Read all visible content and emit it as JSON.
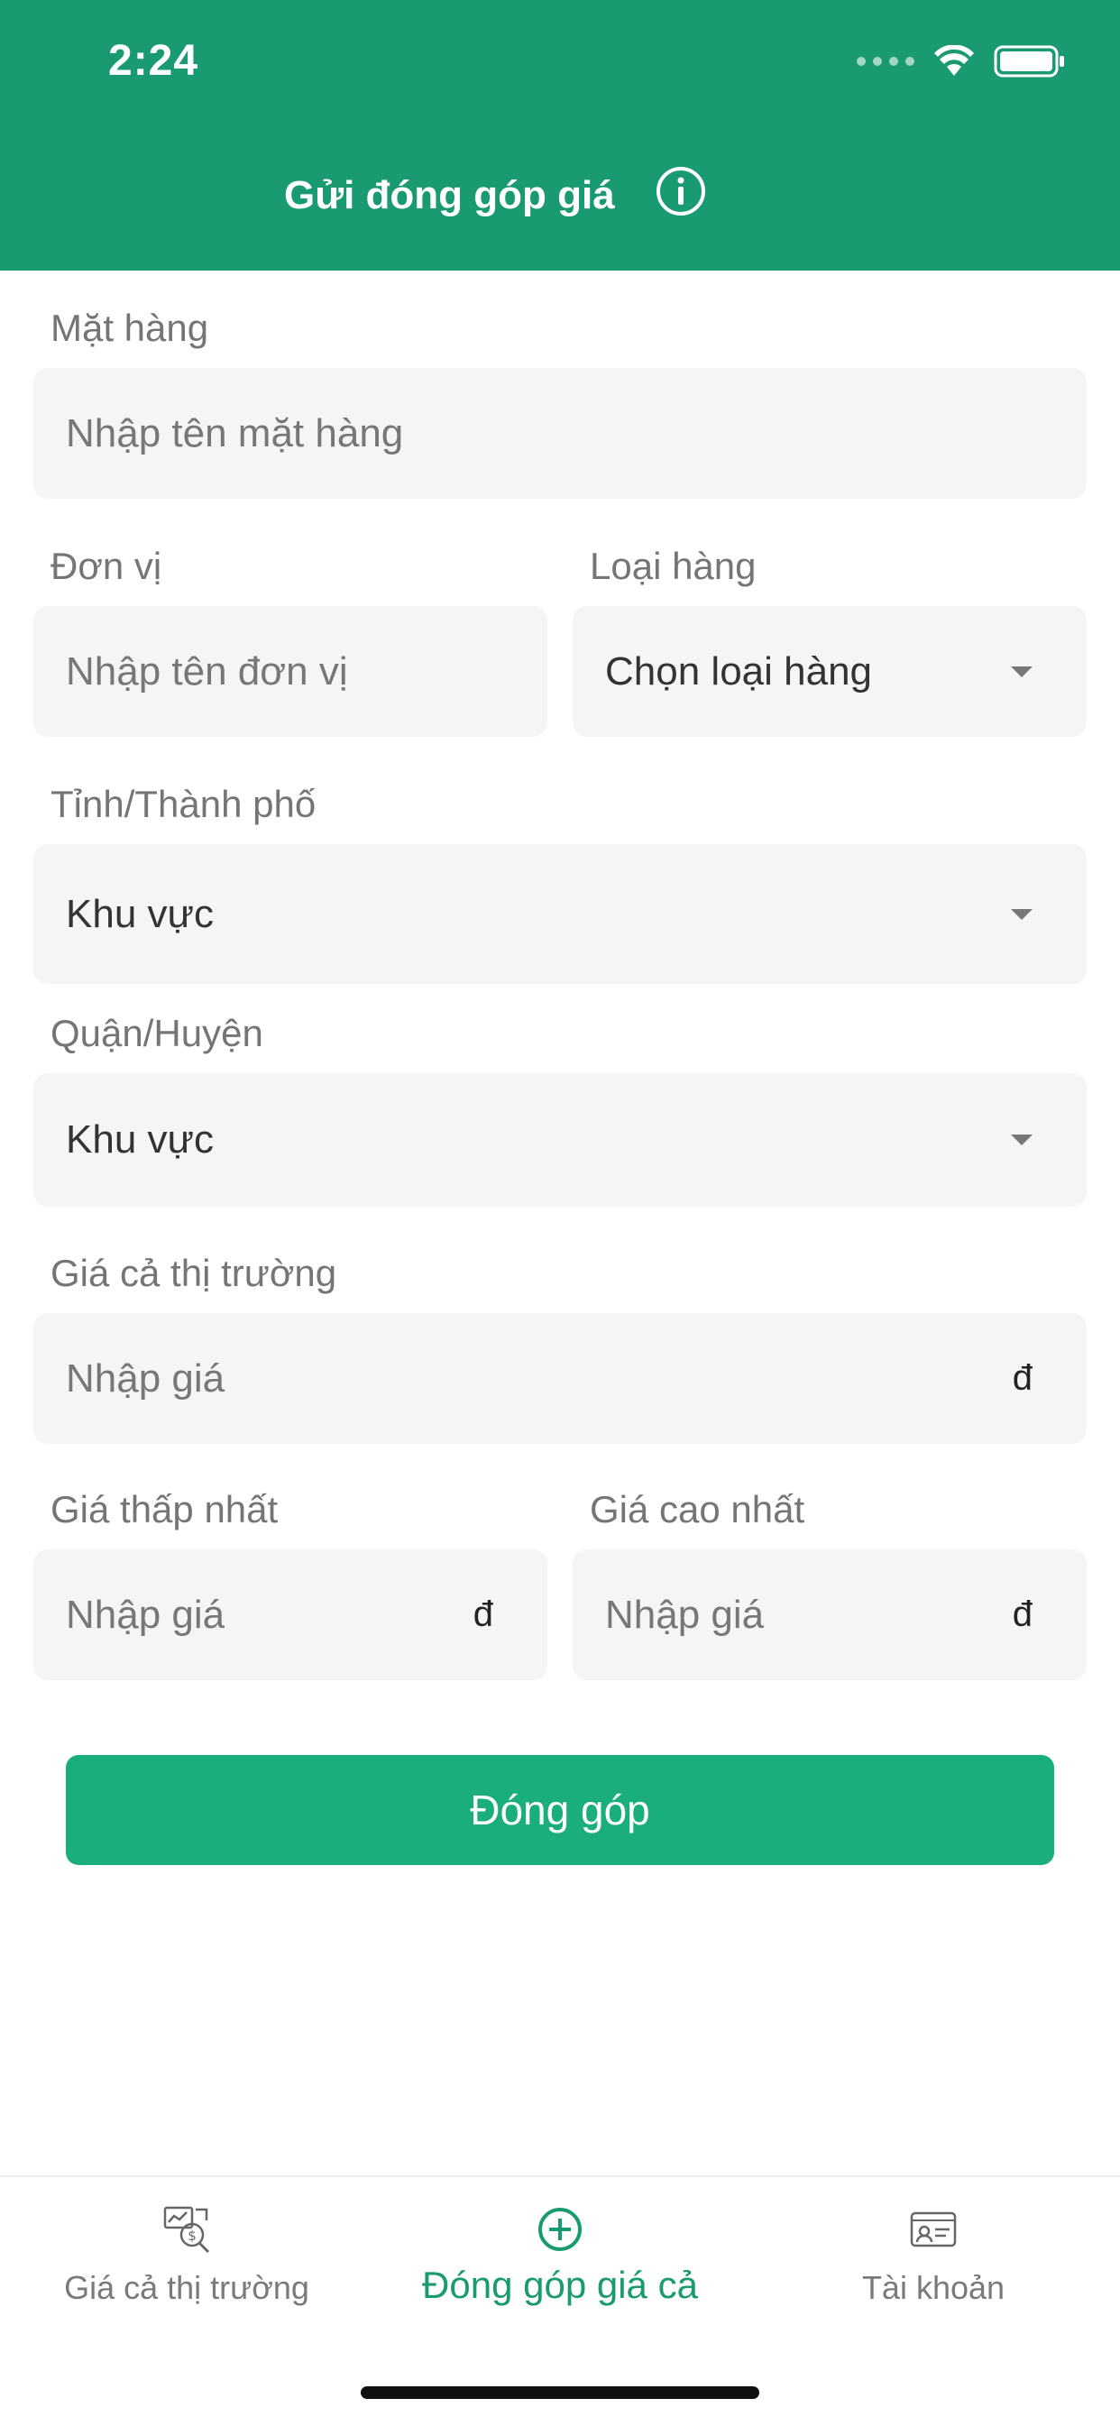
{
  "status_bar": {
    "time": "2:24"
  },
  "header": {
    "title": "Gửi đóng góp giá"
  },
  "form": {
    "item": {
      "label": "Mặt hàng",
      "placeholder": "Nhập tên mặt hàng"
    },
    "unit": {
      "label": "Đơn vị",
      "placeholder": "Nhập tên đơn vị"
    },
    "category": {
      "label": "Loại hàng",
      "value": "Chọn loại hàng"
    },
    "province": {
      "label": "Tỉnh/Thành phố",
      "value": "Khu vực"
    },
    "district": {
      "label": "Quận/Huyện",
      "value": "Khu vực"
    },
    "market_price": {
      "label": "Giá cả thị trường",
      "placeholder": "Nhập giá",
      "suffix": "đ"
    },
    "min_price": {
      "label": "Giá thấp nhất",
      "placeholder": "Nhập giá",
      "suffix": "đ"
    },
    "max_price": {
      "label": "Giá cao nhất",
      "placeholder": "Nhập giá",
      "suffix": "đ"
    },
    "submit_label": "Đóng góp"
  },
  "tabs": [
    {
      "label": "Giá cả thị trường",
      "icon": "market-price-icon",
      "active": false
    },
    {
      "label": "Đóng góp giá cả",
      "icon": "add-circle-icon",
      "active": true
    },
    {
      "label": "Tài khoản",
      "icon": "account-card-icon",
      "active": false
    }
  ],
  "colors": {
    "primary": "#1a9a70",
    "button": "#1aae7c",
    "field_bg": "#f4f5f7"
  }
}
